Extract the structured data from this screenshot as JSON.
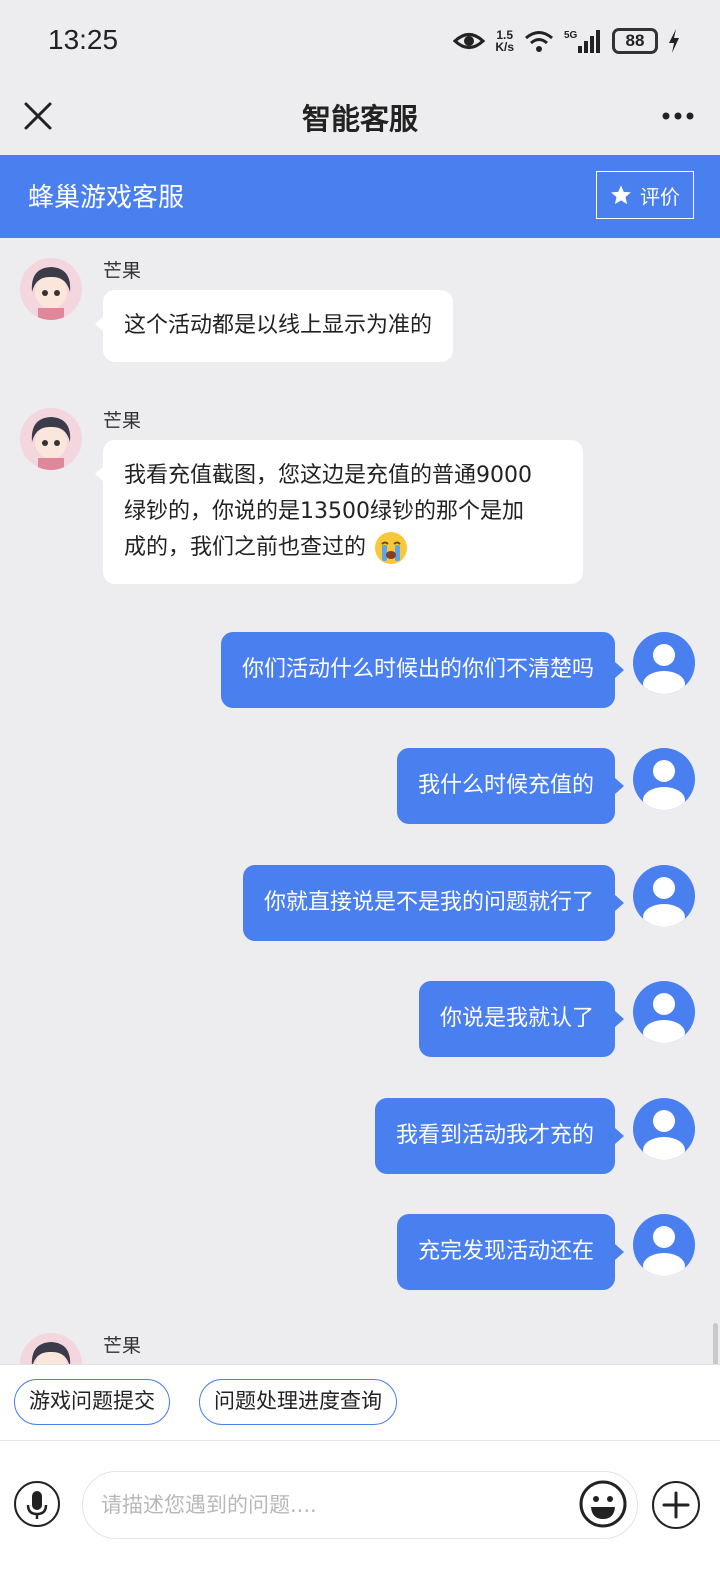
{
  "status_bar": {
    "time": "13:25",
    "net_speed_value": "1.5",
    "net_speed_unit": "K/s",
    "network": "5G",
    "battery": "88",
    "icons": [
      "eye-icon",
      "wifi-icon",
      "signal-icon",
      "battery-icon",
      "charging-icon"
    ]
  },
  "title_bar": {
    "title": "智能客服",
    "close_icon": "close-icon",
    "more_icon": "more-icon"
  },
  "service_bar": {
    "title": "蜂巢游戏客服",
    "rate_label": "评价",
    "rate_icon": "star-icon",
    "color": "#4a7ff0"
  },
  "messages": [
    {
      "side": "in",
      "sender": "芒果",
      "text": "这个活动都是以线上显示为准的"
    },
    {
      "side": "in",
      "sender": "芒果",
      "lines": [
        "我看充值截图，您这边是充值的普通9000",
        "绿钞的，你说的是13500绿钞的那个是加",
        "成的，我们之前也查过的"
      ],
      "emoji": "crying-emoji"
    },
    {
      "side": "out",
      "text": "你们活动什么时候出的你们不清楚吗"
    },
    {
      "side": "out",
      "text": "我什么时候充值的"
    },
    {
      "side": "out",
      "text": "你就直接说是不是我的问题就行了"
    },
    {
      "side": "out",
      "text": "你说是我就认了"
    },
    {
      "side": "out",
      "text": "我看到活动我才充的"
    },
    {
      "side": "out",
      "text": "充完发现活动还在"
    },
    {
      "side": "in",
      "sender": "芒果",
      "text": ""
    }
  ],
  "quick_actions": [
    "游戏问题提交",
    "问题处理进度查询"
  ],
  "input_bar": {
    "placeholder": "请描述您遇到的问题....",
    "value": "",
    "icons": [
      "microphone-icon",
      "emoji-icon",
      "plus-icon"
    ]
  },
  "colors": {
    "accent": "#4a7ff0",
    "background": "#ededf0",
    "incoming_bubble": "#ffffff"
  }
}
